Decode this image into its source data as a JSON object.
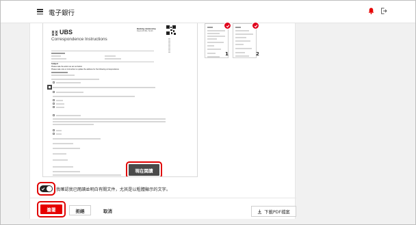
{
  "header": {
    "menu_icon": "hamburger-menu-icon",
    "title": "電子銀行",
    "notification_icon": "bell-icon",
    "notification_color": "#e60000",
    "logout_icon": "logout-icon"
  },
  "document": {
    "logo_text": "UBS",
    "doc_title": "Correspondence Instructions",
    "side_note": "Banking relationship",
    "side_note2": "Dears Mr./Ms. Smith",
    "subject": "Subject",
    "subject_line": "Please take the action as set out below",
    "section_line": "Please take note or instruction to update the address for the following correspondence",
    "read_now_button": "現在閱讀"
  },
  "thumbnails": [
    {
      "page": "1",
      "selected": true
    },
    {
      "page": "2",
      "selected": true
    }
  ],
  "consent": {
    "toggle_on": true,
    "text": "我確認我已閱讀並明白有關文件，尤其是以粗體顯示的文字。"
  },
  "actions": {
    "agree": "簽署",
    "reject": "拒絕",
    "cancel": "取消",
    "download": "下載PDF檔案",
    "download_icon": "download-icon",
    "accent": "#e60000"
  }
}
